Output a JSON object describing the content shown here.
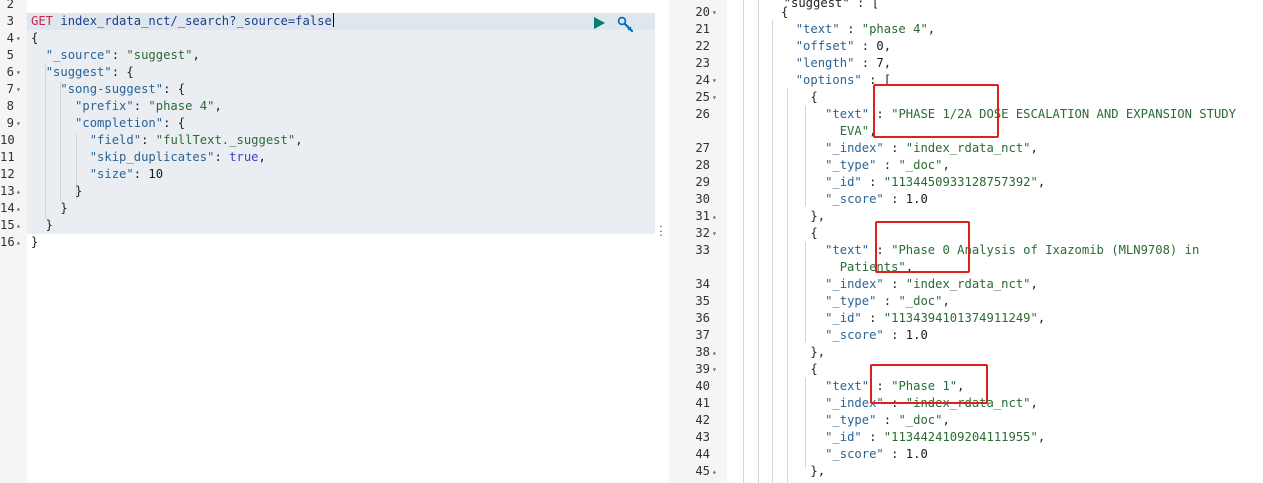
{
  "request": {
    "lines": [
      {
        "n": "2",
        "fold": "",
        "tokens": []
      },
      {
        "n": "3",
        "fold": "",
        "tokens": [
          [
            "m",
            "GET"
          ],
          [
            "p",
            " "
          ],
          [
            "u",
            "index_rdata_nct/_search?_source=false"
          ]
        ]
      },
      {
        "n": "4",
        "fold": "▾",
        "tokens": [
          [
            "p",
            "{"
          ]
        ]
      },
      {
        "n": "5",
        "fold": "",
        "tokens": [
          [
            "p",
            "  "
          ],
          [
            "k",
            "\"_source\""
          ],
          [
            "p",
            ": "
          ],
          [
            "s",
            "\"suggest\""
          ],
          [
            "p",
            ","
          ]
        ]
      },
      {
        "n": "6",
        "fold": "▾",
        "tokens": [
          [
            "p",
            "  "
          ],
          [
            "k",
            "\"suggest\""
          ],
          [
            "p",
            ": {"
          ]
        ]
      },
      {
        "n": "7",
        "fold": "▾",
        "tokens": [
          [
            "p",
            "    "
          ],
          [
            "k",
            "\"song-suggest\""
          ],
          [
            "p",
            ": {"
          ]
        ]
      },
      {
        "n": "8",
        "fold": "",
        "tokens": [
          [
            "p",
            "      "
          ],
          [
            "k",
            "\"prefix\""
          ],
          [
            "p",
            ": "
          ],
          [
            "s",
            "\"phase 4\""
          ],
          [
            "p",
            ","
          ]
        ]
      },
      {
        "n": "9",
        "fold": "▾",
        "tokens": [
          [
            "p",
            "      "
          ],
          [
            "k",
            "\"completion\""
          ],
          [
            "p",
            ": {"
          ]
        ]
      },
      {
        "n": "10",
        "fold": "",
        "tokens": [
          [
            "p",
            "        "
          ],
          [
            "k",
            "\"field\""
          ],
          [
            "p",
            ": "
          ],
          [
            "s",
            "\"fullText._suggest\""
          ],
          [
            "p",
            ","
          ]
        ]
      },
      {
        "n": "11",
        "fold": "",
        "tokens": [
          [
            "p",
            "        "
          ],
          [
            "k",
            "\"skip_duplicates\""
          ],
          [
            "p",
            ": "
          ],
          [
            "b",
            "true"
          ],
          [
            "p",
            ","
          ]
        ]
      },
      {
        "n": "12",
        "fold": "",
        "tokens": [
          [
            "p",
            "        "
          ],
          [
            "k",
            "\"size\""
          ],
          [
            "p",
            ": "
          ],
          [
            "n",
            "10"
          ]
        ]
      },
      {
        "n": "13",
        "fold": "▴",
        "tokens": [
          [
            "p",
            "      }"
          ]
        ]
      },
      {
        "n": "14",
        "fold": "▴",
        "tokens": [
          [
            "p",
            "    }"
          ]
        ]
      },
      {
        "n": "15",
        "fold": "▴",
        "tokens": [
          [
            "p",
            "  }"
          ]
        ]
      },
      {
        "n": "16",
        "fold": "▴",
        "tokens": [
          [
            "p",
            "}"
          ]
        ]
      }
    ]
  },
  "response": {
    "lines": [
      {
        "n": "20",
        "fold": "▾",
        "tokens": [
          [
            "p",
            "      {"
          ]
        ]
      },
      {
        "n": "21",
        "fold": "",
        "tokens": [
          [
            "p",
            "        "
          ],
          [
            "k",
            "\"text\""
          ],
          [
            "p",
            " : "
          ],
          [
            "s",
            "\"phase 4\""
          ],
          [
            "p",
            ","
          ]
        ]
      },
      {
        "n": "22",
        "fold": "",
        "tokens": [
          [
            "p",
            "        "
          ],
          [
            "k",
            "\"offset\""
          ],
          [
            "p",
            " : "
          ],
          [
            "n",
            "0"
          ],
          [
            "p",
            ","
          ]
        ]
      },
      {
        "n": "23",
        "fold": "",
        "tokens": [
          [
            "p",
            "        "
          ],
          [
            "k",
            "\"length\""
          ],
          [
            "p",
            " : "
          ],
          [
            "n",
            "7"
          ],
          [
            "p",
            ","
          ]
        ]
      },
      {
        "n": "24",
        "fold": "▾",
        "tokens": [
          [
            "p",
            "        "
          ],
          [
            "k",
            "\"options\""
          ],
          [
            "p",
            " : ["
          ]
        ]
      },
      {
        "n": "25",
        "fold": "▾",
        "tokens": [
          [
            "p",
            "          {"
          ]
        ]
      },
      {
        "n": "26",
        "fold": "",
        "tokens": [
          [
            "p",
            "            "
          ],
          [
            "k",
            "\"text\""
          ],
          [
            "p",
            " : "
          ],
          [
            "s",
            "\"PHASE 1/2A DOSE ESCALATION AND EXPANSION STUDY"
          ]
        ]
      },
      {
        "n": "",
        "fold": "",
        "tokens": [
          [
            "s",
            "              EVA\""
          ],
          [
            "p",
            ","
          ]
        ]
      },
      {
        "n": "27",
        "fold": "",
        "tokens": [
          [
            "p",
            "            "
          ],
          [
            "k",
            "\"_index\""
          ],
          [
            "p",
            " : "
          ],
          [
            "s",
            "\"index_rdata_nct\""
          ],
          [
            "p",
            ","
          ]
        ]
      },
      {
        "n": "28",
        "fold": "",
        "tokens": [
          [
            "p",
            "            "
          ],
          [
            "k",
            "\"_type\""
          ],
          [
            "p",
            " : "
          ],
          [
            "s",
            "\"_doc\""
          ],
          [
            "p",
            ","
          ]
        ]
      },
      {
        "n": "29",
        "fold": "",
        "tokens": [
          [
            "p",
            "            "
          ],
          [
            "k",
            "\"_id\""
          ],
          [
            "p",
            " : "
          ],
          [
            "s",
            "\"1134450933128757392\""
          ],
          [
            "p",
            ","
          ]
        ]
      },
      {
        "n": "30",
        "fold": "",
        "tokens": [
          [
            "p",
            "            "
          ],
          [
            "k",
            "\"_score\""
          ],
          [
            "p",
            " : "
          ],
          [
            "n",
            "1.0"
          ]
        ]
      },
      {
        "n": "31",
        "fold": "▴",
        "tokens": [
          [
            "p",
            "          },"
          ]
        ]
      },
      {
        "n": "32",
        "fold": "▾",
        "tokens": [
          [
            "p",
            "          {"
          ]
        ]
      },
      {
        "n": "33",
        "fold": "",
        "tokens": [
          [
            "p",
            "            "
          ],
          [
            "k",
            "\"text\""
          ],
          [
            "p",
            " : "
          ],
          [
            "s",
            "\"Phase 0 Analysis of Ixazomib (MLN9708) in"
          ]
        ]
      },
      {
        "n": "",
        "fold": "",
        "tokens": [
          [
            "s",
            "              Patients\""
          ],
          [
            "p",
            ","
          ]
        ]
      },
      {
        "n": "34",
        "fold": "",
        "tokens": [
          [
            "p",
            "            "
          ],
          [
            "k",
            "\"_index\""
          ],
          [
            "p",
            " : "
          ],
          [
            "s",
            "\"index_rdata_nct\""
          ],
          [
            "p",
            ","
          ]
        ]
      },
      {
        "n": "35",
        "fold": "",
        "tokens": [
          [
            "p",
            "            "
          ],
          [
            "k",
            "\"_type\""
          ],
          [
            "p",
            " : "
          ],
          [
            "s",
            "\"_doc\""
          ],
          [
            "p",
            ","
          ]
        ]
      },
      {
        "n": "36",
        "fold": "",
        "tokens": [
          [
            "p",
            "            "
          ],
          [
            "k",
            "\"_id\""
          ],
          [
            "p",
            " : "
          ],
          [
            "s",
            "\"1134394101374911249\""
          ],
          [
            "p",
            ","
          ]
        ]
      },
      {
        "n": "37",
        "fold": "",
        "tokens": [
          [
            "p",
            "            "
          ],
          [
            "k",
            "\"_score\""
          ],
          [
            "p",
            " : "
          ],
          [
            "n",
            "1.0"
          ]
        ]
      },
      {
        "n": "38",
        "fold": "▴",
        "tokens": [
          [
            "p",
            "          },"
          ]
        ]
      },
      {
        "n": "39",
        "fold": "▾",
        "tokens": [
          [
            "p",
            "          {"
          ]
        ]
      },
      {
        "n": "40",
        "fold": "",
        "tokens": [
          [
            "p",
            "            "
          ],
          [
            "k",
            "\"text\""
          ],
          [
            "p",
            " : "
          ],
          [
            "s",
            "\"Phase 1\""
          ],
          [
            "p",
            ","
          ]
        ]
      },
      {
        "n": "41",
        "fold": "",
        "tokens": [
          [
            "p",
            "            "
          ],
          [
            "k",
            "\"_index\""
          ],
          [
            "p",
            " : "
          ],
          [
            "s",
            "\"index_rdata_nct\""
          ],
          [
            "p",
            ","
          ]
        ]
      },
      {
        "n": "42",
        "fold": "",
        "tokens": [
          [
            "p",
            "            "
          ],
          [
            "k",
            "\"_type\""
          ],
          [
            "p",
            " : "
          ],
          [
            "s",
            "\"_doc\""
          ],
          [
            "p",
            ","
          ]
        ]
      },
      {
        "n": "43",
        "fold": "",
        "tokens": [
          [
            "p",
            "            "
          ],
          [
            "k",
            "\"_id\""
          ],
          [
            "p",
            " : "
          ],
          [
            "s",
            "\"1134424109204111955\""
          ],
          [
            "p",
            ","
          ]
        ]
      },
      {
        "n": "44",
        "fold": "",
        "tokens": [
          [
            "p",
            "            "
          ],
          [
            "k",
            "\"_score\""
          ],
          [
            "p",
            " : "
          ],
          [
            "n",
            "1.0"
          ]
        ]
      },
      {
        "n": "45",
        "fold": "▴",
        "tokens": [
          [
            "p",
            "          },"
          ]
        ]
      }
    ]
  },
  "toolbar": {
    "run_icon": "play-icon",
    "settings_icon": "wrench-icon",
    "run_color": "#017d73",
    "settings_color": "#006bb4"
  },
  "colors": {
    "highlight_box": "#e0201c",
    "request_band": "#eaeef2",
    "active_line": "#dfe6ed"
  }
}
